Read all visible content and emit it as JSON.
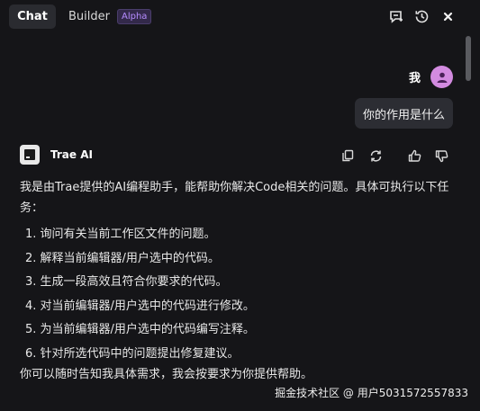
{
  "tabs": {
    "chat_label": "Chat",
    "builder_label": "Builder",
    "builder_badge": "Alpha"
  },
  "toolbar": {
    "icons": [
      "new-chat-icon",
      "history-icon",
      "close-icon"
    ]
  },
  "user_message": {
    "name": "我",
    "text": "你的作用是什么"
  },
  "ai_message": {
    "name": "Trae AI",
    "actions": [
      "copy-icon",
      "regenerate-icon",
      "thumbs-up-icon",
      "thumbs-down-icon"
    ],
    "intro": "我是由Trae提供的AI编程助手，能帮助你解决Code相关的问题。具体可执行以下任务：",
    "items": [
      "1. 询问有关当前工作区文件的问题。",
      "2. 解释当前编辑器/用户选中的代码。",
      "3. 生成一段高效且符合你要求的代码。",
      "4. 对当前编辑器/用户选中的代码进行修改。",
      "5. 为当前编辑器/用户选中的代码编写注释。",
      "6. 针对所选代码中的问题提出修复建议。"
    ],
    "outro": "你可以随时告知我具体需求，我会按要求为你提供帮助。"
  },
  "watermark": "掘金技术社区 @ 用户5031572557833",
  "colors": {
    "background": "#151518",
    "accent_badge": "#b68cff",
    "avatar": "#d38be0",
    "bubble": "#2c2d33"
  }
}
